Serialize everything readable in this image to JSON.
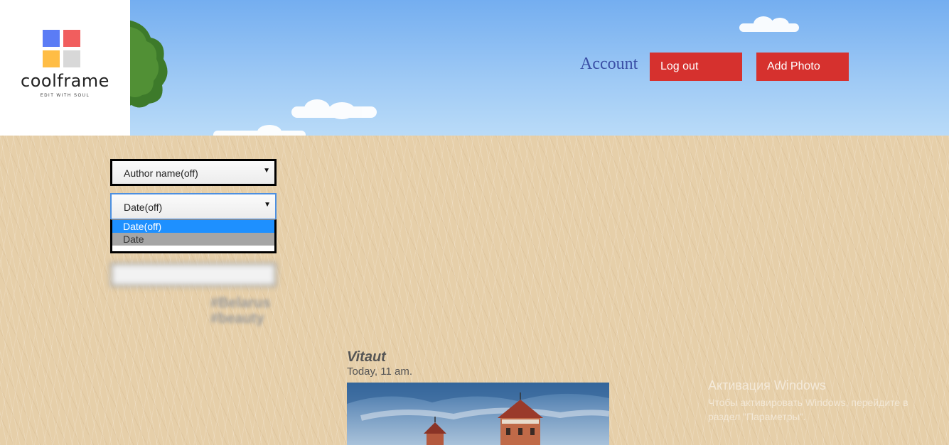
{
  "brand": {
    "name": "coolframe",
    "tagline": "EDIT WITH SOUL"
  },
  "header": {
    "account_label": "Account",
    "logout_label": "Log out",
    "add_photo_label": "Add Photo"
  },
  "filters": {
    "author_select": {
      "value": "Author name(off)"
    },
    "date_select": {
      "value": "Date(off)",
      "options": [
        "Date(off)",
        "Date"
      ],
      "highlighted": "Date(off)",
      "hovered": "Date"
    }
  },
  "blurred": {
    "tags": [
      "#Belarus",
      "#beauty"
    ]
  },
  "post": {
    "author": "Vitaut",
    "time": "Today, 11 am."
  },
  "windows_watermark": {
    "title": "Активация Windows",
    "subtitle": "Чтобы активировать Windows, перейдите в раздел \"Параметры\"."
  }
}
